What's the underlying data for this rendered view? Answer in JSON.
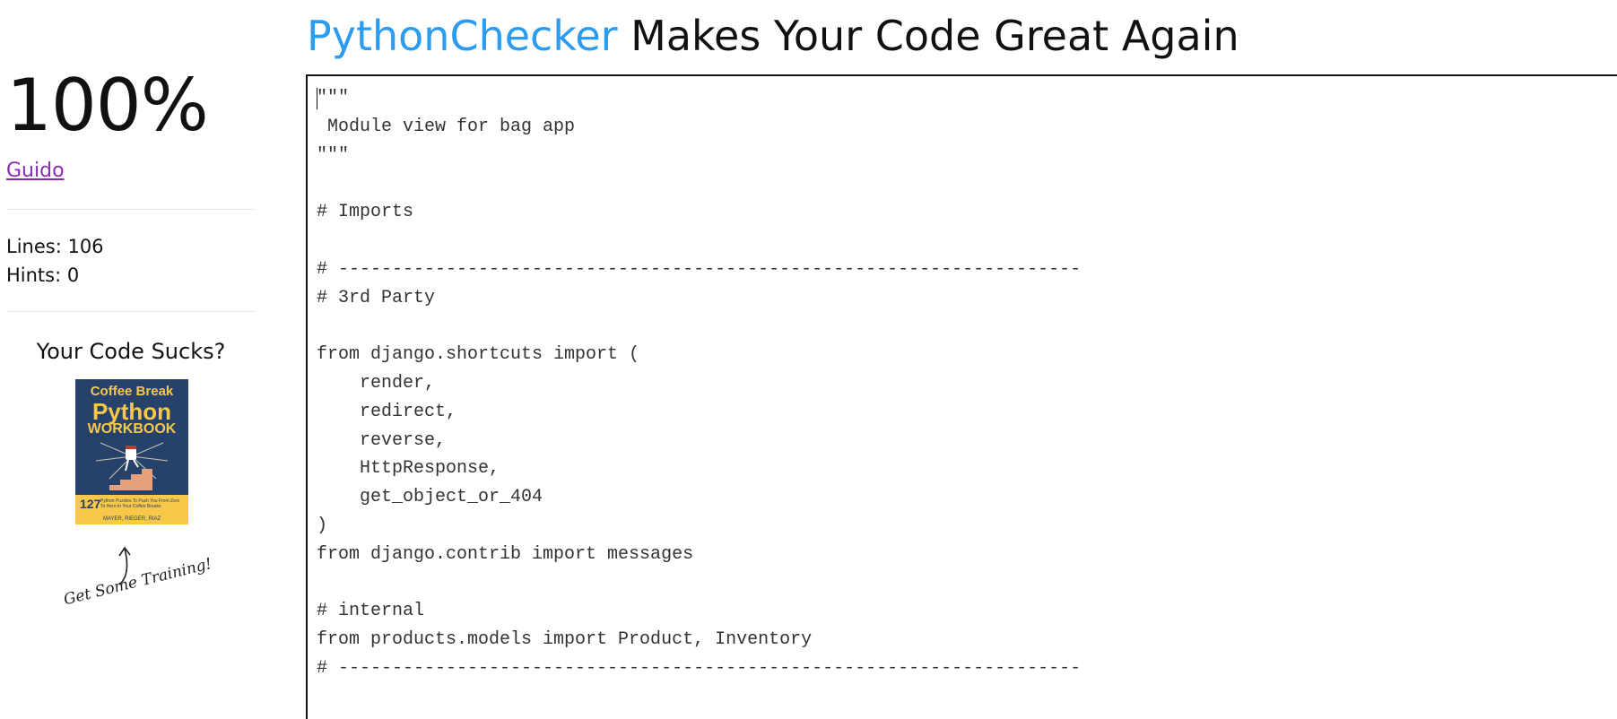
{
  "header": {
    "brand": "PythonChecker",
    "tagline": " Makes Your Code Great Again"
  },
  "sidebar": {
    "score": "100%",
    "author_link": "Guido",
    "lines_label": "Lines: 106",
    "hints_label": "Hints: 0",
    "promo_title": "Your Code Sucks?",
    "book": {
      "line1": "Coffee Break",
      "line2": "Python",
      "line3": "WORKBOOK",
      "number": "127",
      "subtitle": "Python Puzzles To Push You From Zero To Hero In Your Coffee Breaks",
      "authors": "MAYER, RIEGER, RIAZ"
    },
    "training_note": "Get Some Training!"
  },
  "editor": {
    "code": "\"\"\"\n Module view for bag app\n\"\"\"\n\n# Imports\n\n# ---------------------------------------------------------------------\n# 3rd Party\n\nfrom django.shortcuts import (\n    render,\n    redirect,\n    reverse,\n    HttpResponse,\n    get_object_or_404\n)\nfrom django.contrib import messages\n\n# internal\nfrom products.models import Product, Inventory\n# ---------------------------------------------------------------------"
  },
  "colors": {
    "brand": "#2c9cf0",
    "link": "#8a2bb4",
    "book_cover": "#27426a",
    "book_accent": "#f7c84a"
  }
}
